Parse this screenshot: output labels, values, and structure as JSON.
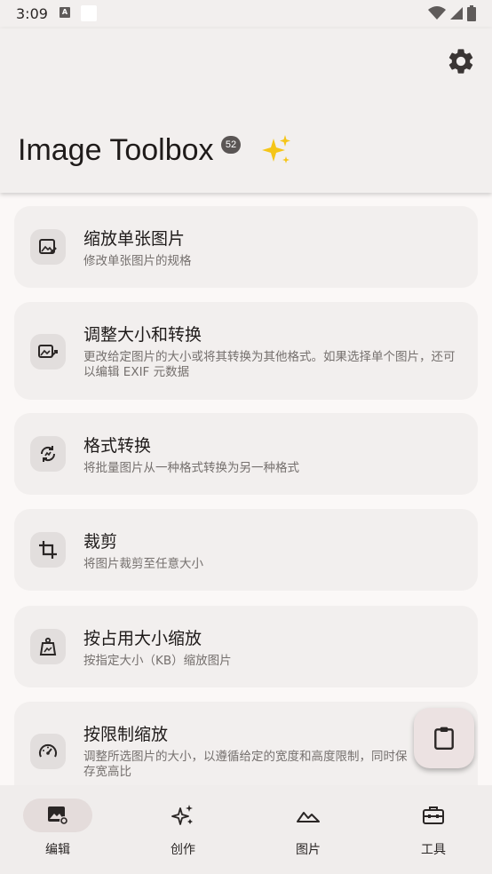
{
  "status": {
    "time": "3:09",
    "a_icon": "A"
  },
  "app": {
    "title": "Image Toolbox",
    "badge": "52"
  },
  "tools": [
    {
      "title": "缩放单张图片",
      "subtitle": "修改单张图片的规格",
      "icon": "image-edit-icon"
    },
    {
      "title": "调整大小和转换",
      "subtitle": "更改给定图片的大小或将其转换为其他格式。如果选择单个图片，还可以编辑 EXIF 元数据",
      "icon": "image-resize-icon"
    },
    {
      "title": "格式转换",
      "subtitle": "将批量图片从一种格式转换为另一种格式",
      "icon": "convert-icon"
    },
    {
      "title": "裁剪",
      "subtitle": "将图片裁剪至任意大小",
      "icon": "crop-icon"
    },
    {
      "title": "按占用大小缩放",
      "subtitle": "按指定大小（KB）缩放图片",
      "icon": "weight-icon"
    },
    {
      "title": "按限制缩放",
      "subtitle": "调整所选图片的大小，以遵循给定的宽度和高度限制，同时保存宽高比",
      "icon": "speedometer-icon"
    }
  ],
  "nav": [
    {
      "label": "编辑",
      "icon": "image-edit-nav-icon"
    },
    {
      "label": "创作",
      "icon": "sparkles-icon"
    },
    {
      "label": "图片",
      "icon": "landscape-icon"
    },
    {
      "label": "工具",
      "icon": "toolbox-icon"
    }
  ],
  "colors": {
    "background": "#fbf8f7",
    "card": "#f2efee",
    "accent_pill": "#e4dcdb",
    "fab": "#ece2e2"
  }
}
